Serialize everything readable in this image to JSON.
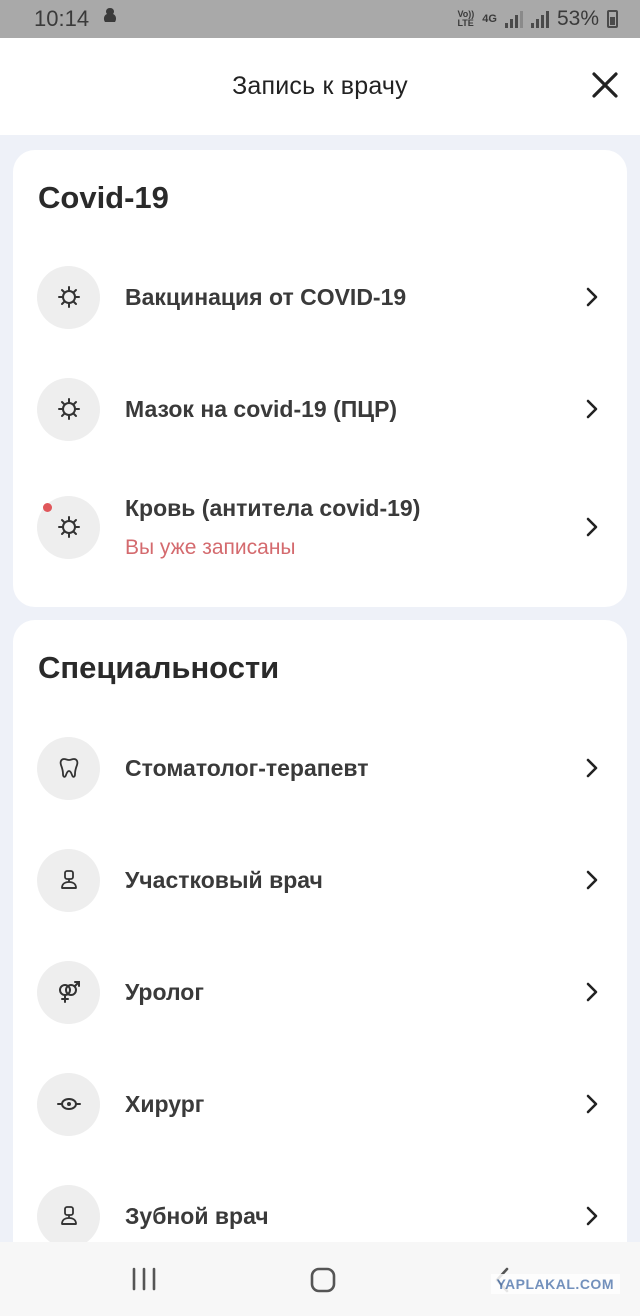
{
  "status_bar": {
    "time": "10:14",
    "volte_top": "Vo))",
    "volte_bottom": "LTE",
    "network": "4G",
    "battery": "53%"
  },
  "header": {
    "title": "Запись к врачу",
    "close_icon": "close-icon"
  },
  "covid_section": {
    "title": "Covid-19",
    "items": [
      {
        "label": "Вакцинация от COVID-19",
        "icon": "virus-icon"
      },
      {
        "label": "Мазок на covid-19 (ПЦР)",
        "icon": "virus-icon"
      },
      {
        "label": "Кровь (антитела covid-19)",
        "sublabel": "Вы уже записаны",
        "icon": "virus-icon",
        "badge": true
      }
    ]
  },
  "specialties_section": {
    "title": "Специальности",
    "items": [
      {
        "label": "Стоматолог-терапевт",
        "icon": "tooth-icon"
      },
      {
        "label": "Участковый врач",
        "icon": "doctor-icon"
      },
      {
        "label": "Уролог",
        "icon": "gender-icon"
      },
      {
        "label": "Хирург",
        "icon": "surgery-icon"
      },
      {
        "label": "Зубной врач",
        "icon": "doctor-icon"
      }
    ]
  },
  "colors": {
    "accent_red": "#d46a6e",
    "badge_red": "#e0575b",
    "background": "#eef1f8"
  },
  "watermark": "YAPLAKAL.COM"
}
